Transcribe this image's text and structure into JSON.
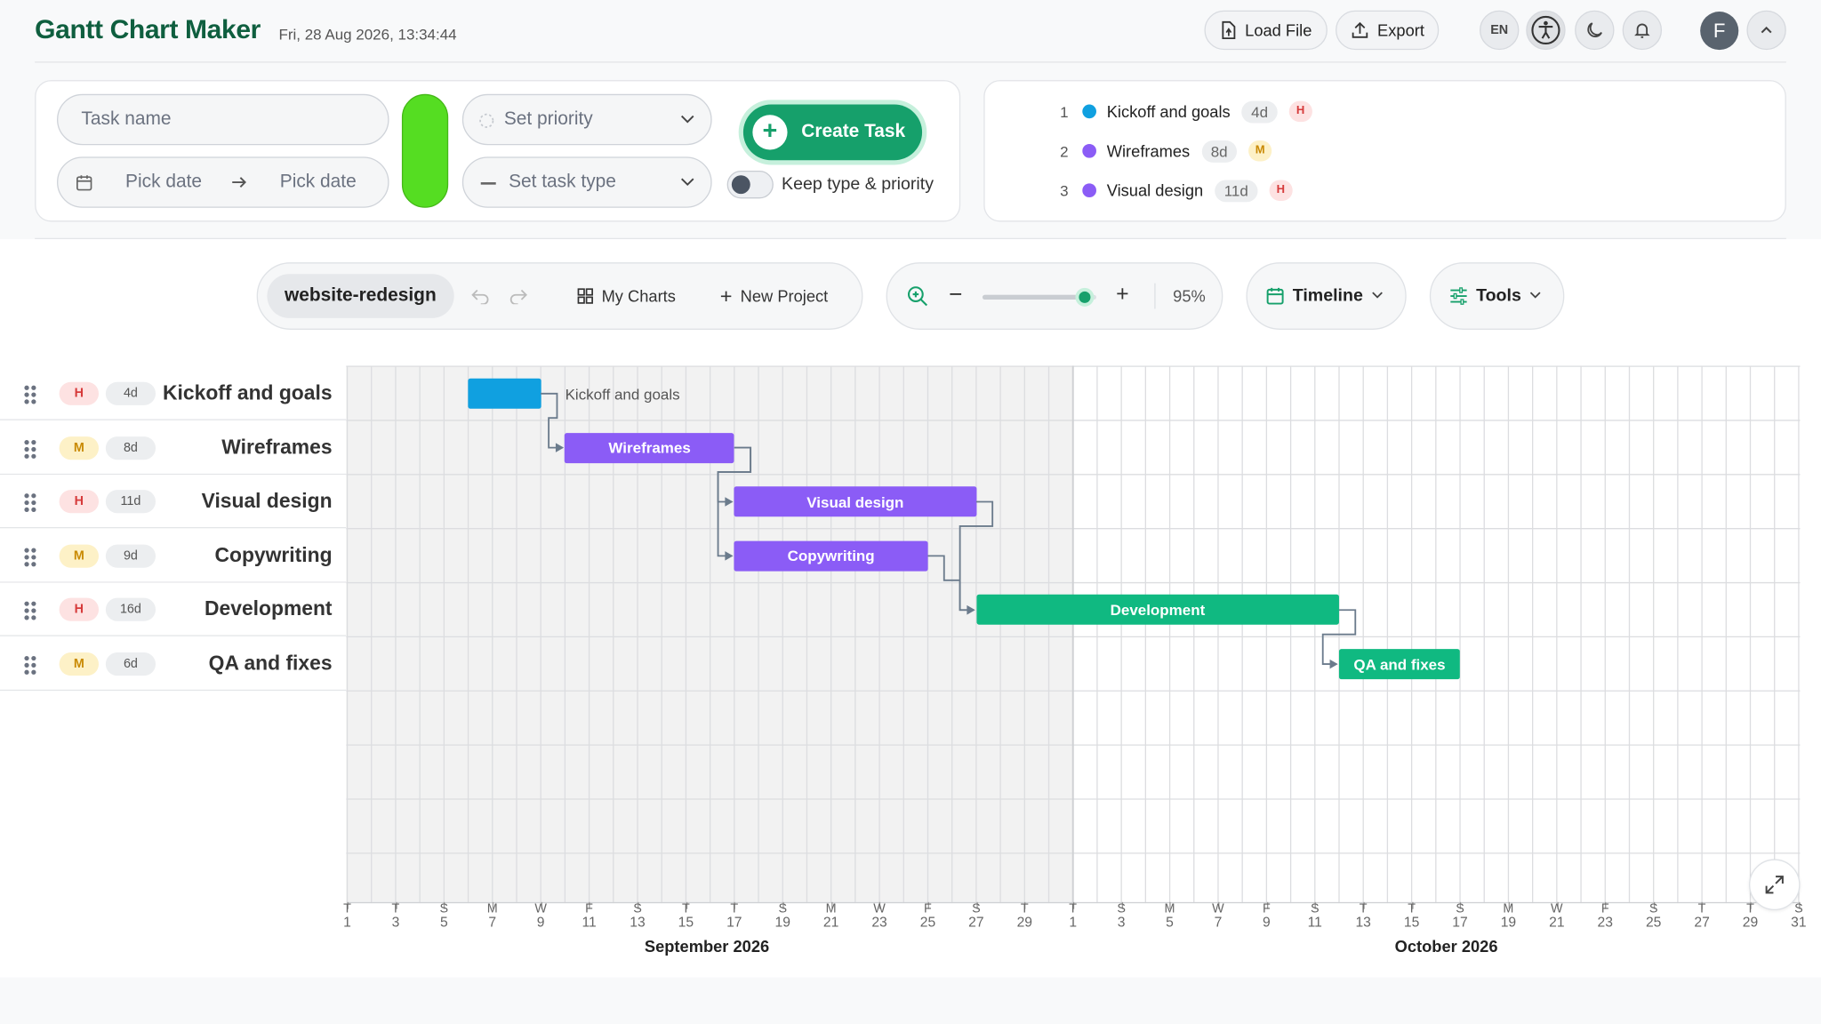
{
  "app": {
    "title": "Gantt Chart Maker",
    "datetime": "Fri, 28 Aug 2026, 13:34:44"
  },
  "header": {
    "load_file": "Load File",
    "export": "Export",
    "language": "EN",
    "avatar_initial": "F"
  },
  "form": {
    "task_name_placeholder": "Task name",
    "start_date_placeholder": "Pick date",
    "end_date_placeholder": "Pick date",
    "priority_placeholder": "Set priority",
    "type_placeholder": "Set task type",
    "create_button": "Create Task",
    "keep_label": "Keep type & priority",
    "color": "#55dd22"
  },
  "task_list": [
    {
      "index": "1",
      "name": "Kickoff and goals",
      "duration": "4d",
      "priority": "H",
      "color": "#10a0e0"
    },
    {
      "index": "2",
      "name": "Wireframes",
      "duration": "8d",
      "priority": "M",
      "color": "#8b5cf6"
    },
    {
      "index": "3",
      "name": "Visual design",
      "duration": "11d",
      "priority": "H",
      "color": "#8b5cf6"
    }
  ],
  "toolbar": {
    "project": "website-redesign",
    "my_charts": "My Charts",
    "new_project": "New Project",
    "zoom_minus": "−",
    "zoom_plus": "+",
    "zoom": "95%",
    "zoom_fraction": 0.9,
    "view": "Timeline",
    "tools": "Tools"
  },
  "tasks": [
    {
      "name": "Kickoff and goals",
      "priority": "H",
      "duration": "4d",
      "start": "2026-09-06",
      "days": 3,
      "color": "#10a0e0",
      "label_outside": true
    },
    {
      "name": "Wireframes",
      "priority": "M",
      "duration": "8d",
      "start": "2026-09-10",
      "days": 7,
      "color": "#8b5cf6"
    },
    {
      "name": "Visual design",
      "priority": "H",
      "duration": "11d",
      "start": "2026-09-17",
      "days": 10,
      "color": "#8b5cf6"
    },
    {
      "name": "Copywriting",
      "priority": "M",
      "duration": "9d",
      "start": "2026-09-17",
      "days": 8,
      "color": "#8b5cf6"
    },
    {
      "name": "Development",
      "priority": "H",
      "duration": "16d",
      "start": "2026-09-27",
      "days": 15,
      "color": "#10b981"
    },
    {
      "name": "QA and fixes",
      "priority": "M",
      "duration": "6d",
      "start": "2026-10-12",
      "days": 5,
      "color": "#10b981"
    }
  ],
  "dependencies": [
    [
      0,
      1
    ],
    [
      1,
      2
    ],
    [
      1,
      3
    ],
    [
      2,
      4
    ],
    [
      3,
      4
    ],
    [
      4,
      5
    ]
  ],
  "timeline": {
    "today": "2026-10-01",
    "ticks": [
      {
        "d": "T",
        "n": "1"
      },
      {
        "d": "T",
        "n": "3"
      },
      {
        "d": "S",
        "n": "5"
      },
      {
        "d": "M",
        "n": "7"
      },
      {
        "d": "W",
        "n": "9"
      },
      {
        "d": "F",
        "n": "11"
      },
      {
        "d": "S",
        "n": "13"
      },
      {
        "d": "T",
        "n": "15"
      },
      {
        "d": "T",
        "n": "17"
      },
      {
        "d": "S",
        "n": "19"
      },
      {
        "d": "M",
        "n": "21"
      },
      {
        "d": "W",
        "n": "23"
      },
      {
        "d": "F",
        "n": "25"
      },
      {
        "d": "S",
        "n": "27"
      },
      {
        "d": "T",
        "n": "29"
      },
      {
        "d": "T",
        "n": "1"
      },
      {
        "d": "S",
        "n": "3"
      },
      {
        "d": "M",
        "n": "5"
      },
      {
        "d": "W",
        "n": "7"
      },
      {
        "d": "F",
        "n": "9"
      },
      {
        "d": "S",
        "n": "11"
      },
      {
        "d": "T",
        "n": "13"
      },
      {
        "d": "T",
        "n": "15"
      },
      {
        "d": "S",
        "n": "17"
      },
      {
        "d": "M",
        "n": "19"
      },
      {
        "d": "W",
        "n": "21"
      },
      {
        "d": "F",
        "n": "23"
      },
      {
        "d": "S",
        "n": "25"
      },
      {
        "d": "T",
        "n": "27"
      },
      {
        "d": "T",
        "n": "29"
      },
      {
        "d": "S",
        "n": "31"
      }
    ],
    "months": [
      "September 2026",
      "October 2026"
    ]
  }
}
